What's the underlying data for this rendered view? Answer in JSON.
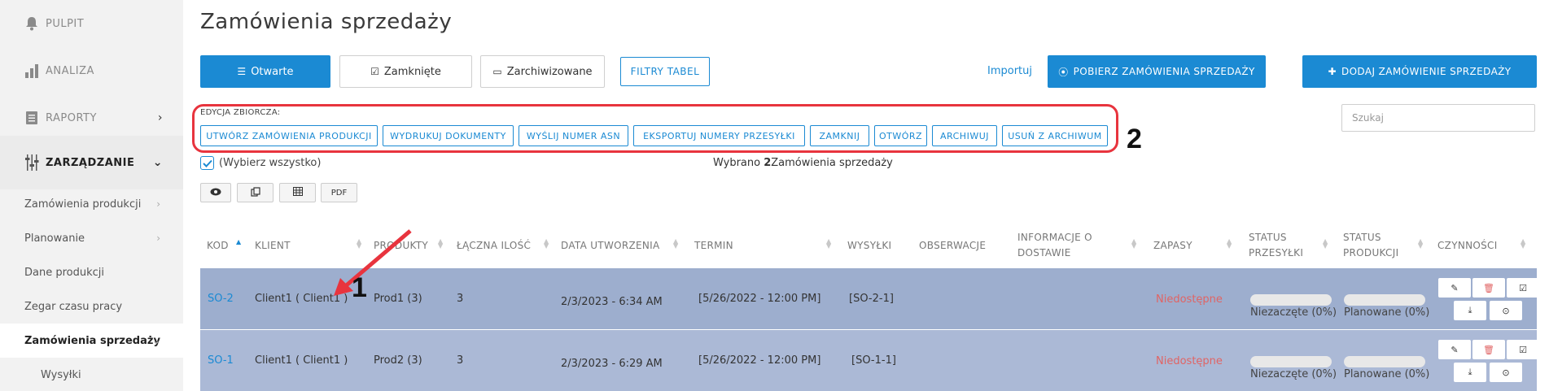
{
  "sidebar": {
    "main": [
      {
        "label": "PULPIT",
        "icon": "bell-icon"
      },
      {
        "label": "ANALIZA",
        "icon": "bar-chart-icon"
      },
      {
        "label": "RAPORTY",
        "icon": "document-icon"
      },
      {
        "label": "ZARZĄDZANIE",
        "icon": "sliders-icon"
      }
    ],
    "sub": [
      {
        "label": "Zamówienia produkcji"
      },
      {
        "label": "Planowanie"
      },
      {
        "label": "Dane produkcji"
      },
      {
        "label": "Zegar czasu pracy"
      },
      {
        "label": "Zamówienia sprzedaży"
      },
      {
        "label": "Wysyłki"
      }
    ]
  },
  "page": {
    "title": "Zamówienia sprzedaży"
  },
  "tabs": {
    "open": "Otwarte",
    "closed": "Zamknięte",
    "archived": "Zarchiwizowane",
    "filters": "FILTRY TABEL"
  },
  "actions": {
    "import": "Importuj",
    "fetch": "POBIERZ ZAMÓWIENIA SPRZEDAŻY",
    "add": "DODAJ ZAMÓWIENIE SPRZEDAŻY"
  },
  "bulk": {
    "label": "EDYCJA ZBIORCZA:",
    "buttons": [
      "UTWÓRZ ZAMÓWIENIA PRODUKCJI",
      "WYDRUKUJ DOKUMENTY",
      "WYŚLIJ NUMER ASN",
      "EKSPORTUJ NUMERY PRZESYŁKI",
      "ZAMKNIJ",
      "OTWÓRZ",
      "ARCHIWUJ",
      "USUŃ Z ARCHIWUM"
    ]
  },
  "search": {
    "placeholder": "Szukaj"
  },
  "select_all": {
    "label": "(Wybierz wszystko)"
  },
  "selection": {
    "prefix": "Wybrano ",
    "count": "2",
    "suffix": "Zamówienia sprzedaży"
  },
  "toolbar": {
    "pdf": "PDF"
  },
  "table": {
    "headers": {
      "code": "KOD",
      "client": "KLIENT",
      "products": "PRODUKTY",
      "qty": "ŁĄCZNA ILOŚĆ",
      "created": "DATA UTWORZENIA",
      "term": "TERMIN",
      "shipments": "WYSYŁKI",
      "notes": "OBSERWACJE",
      "delivery_1": "INFORMACJE O",
      "delivery_2": "DOSTAWIE",
      "stock": "ZAPASY",
      "ship_status_1": "STATUS",
      "ship_status_2": "PRZESYŁKI",
      "prod_status_1": "STATUS",
      "prod_status_2": "PRODUKCJI",
      "actions": "CZYNNOŚCI"
    },
    "rows": [
      {
        "code": "SO-2",
        "client": "Client1 ( Client1 )",
        "products": "Prod1 (3)",
        "qty": "3",
        "created": "2/3/2023 - 6:34 AM",
        "term": "[5/26/2022 - 12:00 PM]",
        "shipments": "[SO-2-1]",
        "stock": "Niedostępne",
        "ship_status": "Niezaczęte (0%)",
        "prod_status": "Planowane (0%)"
      },
      {
        "code": "SO-1",
        "client": "Client1 ( Client1 )",
        "products": "Prod2 (3)",
        "qty": "3",
        "created": "2/3/2023 - 6:29 AM",
        "term": "[5/26/2022 - 12:00 PM]",
        "shipments": "[SO-1-1]",
        "stock": "Niedostępne",
        "ship_status": "Niezaczęte (0%)",
        "prod_status": "Planowane (0%)"
      }
    ]
  },
  "annotations": {
    "marker_1": "1",
    "marker_2": "2"
  },
  "colors": {
    "accent": "#1b8ad3",
    "highlight": "#e8343e",
    "row_selected": "#9daece",
    "unavailable": "#e06464"
  }
}
